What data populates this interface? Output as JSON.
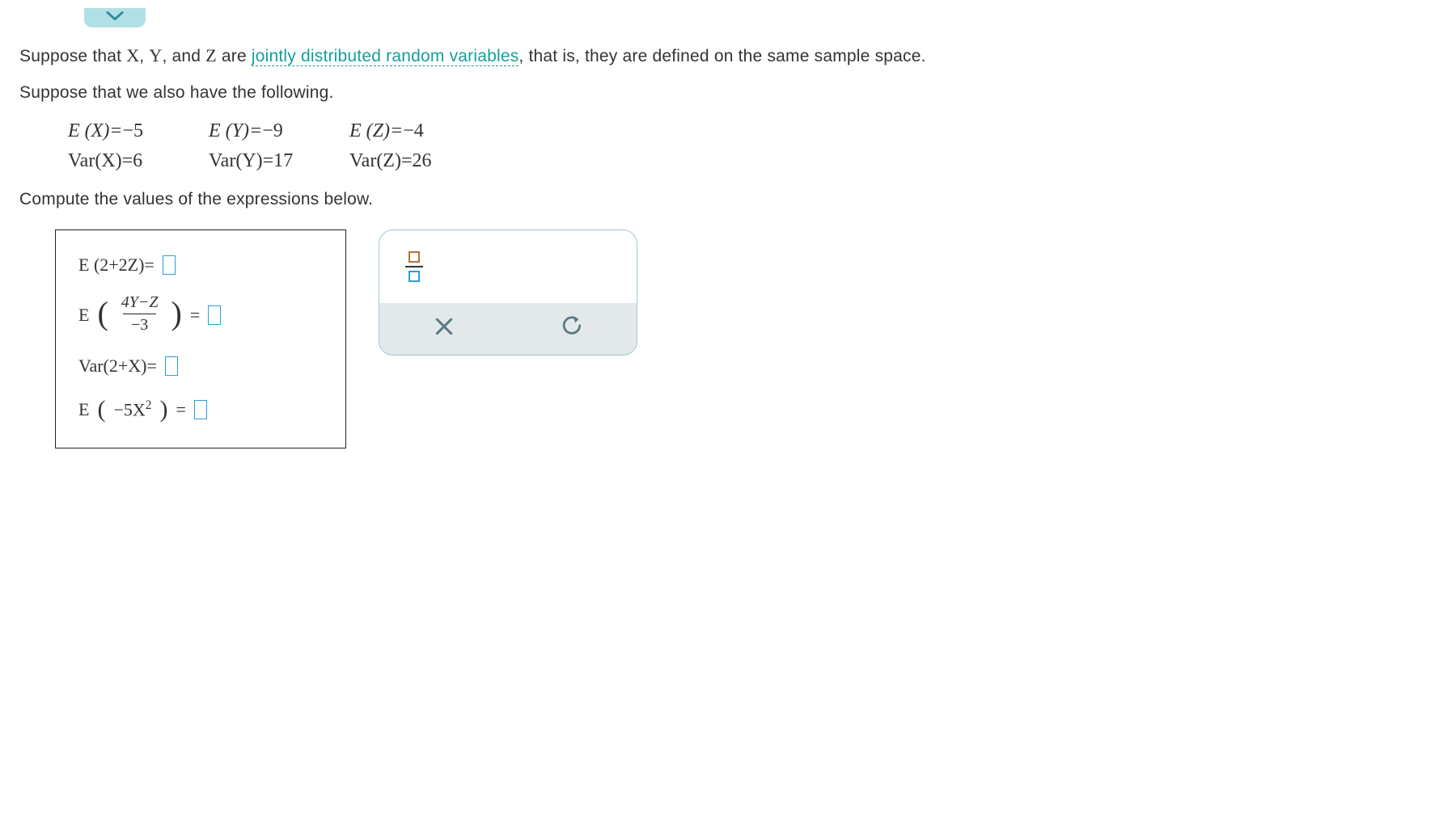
{
  "intro_prefix": "Suppose that ",
  "vars": {
    "x": "X",
    "y": "Y",
    "z": "Z"
  },
  "intro_mid1": ", ",
  "intro_mid2": ", and ",
  "intro_mid3": " are ",
  "link_text": "jointly distributed random variables",
  "intro_suffix": ", that is, they are defined on the same sample space.",
  "line2": "Suppose that we also have the following.",
  "given": {
    "ex_label": "E (X)=",
    "ex_val": "−5",
    "ey_label": "E (Y)=",
    "ey_val": "−9",
    "ez_label": "E (Z)=",
    "ez_val": "−4",
    "vx_label": "Var(X)=",
    "vx_val": "6",
    "vy_label": "Var(Y)=",
    "vy_val": "17",
    "vz_label": "Var(Z)=",
    "vz_val": "26"
  },
  "compute_line": "Compute the values of the expressions below.",
  "exprs": {
    "e1_pre": "E (2+2Z)= ",
    "e2_E": "E",
    "e2_num": "4Y−Z",
    "e2_den": "−3",
    "e2_eq": "= ",
    "e3_pre": "Var(2+X)= ",
    "e4_E": "E",
    "e4_inner": "−5X",
    "e4_exp": "2",
    "e4_eq": "= "
  },
  "tools": {
    "fraction": "fraction",
    "clear": "clear",
    "undo": "undo"
  }
}
